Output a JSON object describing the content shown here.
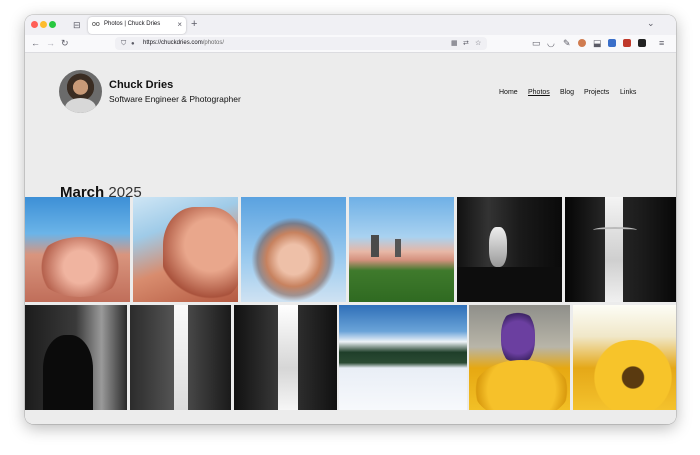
{
  "browser": {
    "tab_title": "Photos | Chuck Dries",
    "favicon": "oo",
    "new_tab": "+",
    "url_domain": "https://chuckdries.com",
    "url_path": "/photos/"
  },
  "site": {
    "name": "Chuck Dries",
    "tagline": "Software Engineer & Photographer",
    "nav": [
      {
        "label": "Home",
        "active": false
      },
      {
        "label": "Photos",
        "active": true
      },
      {
        "label": "Blog",
        "active": false
      },
      {
        "label": "Projects",
        "active": false
      },
      {
        "label": "Links",
        "active": false
      }
    ]
  },
  "gallery": {
    "month": "March",
    "year": "2025"
  },
  "icons": {
    "back": "←",
    "forward": "→",
    "reload": "↻",
    "shield": "⛉",
    "lock": "🔒",
    "grid": "▦",
    "translate": "⇄",
    "star": "☆",
    "menu": "≡",
    "chevron": "⌄",
    "folder": "⊟"
  },
  "colors": {
    "page_bg": "#ececec",
    "text": "#111111"
  }
}
